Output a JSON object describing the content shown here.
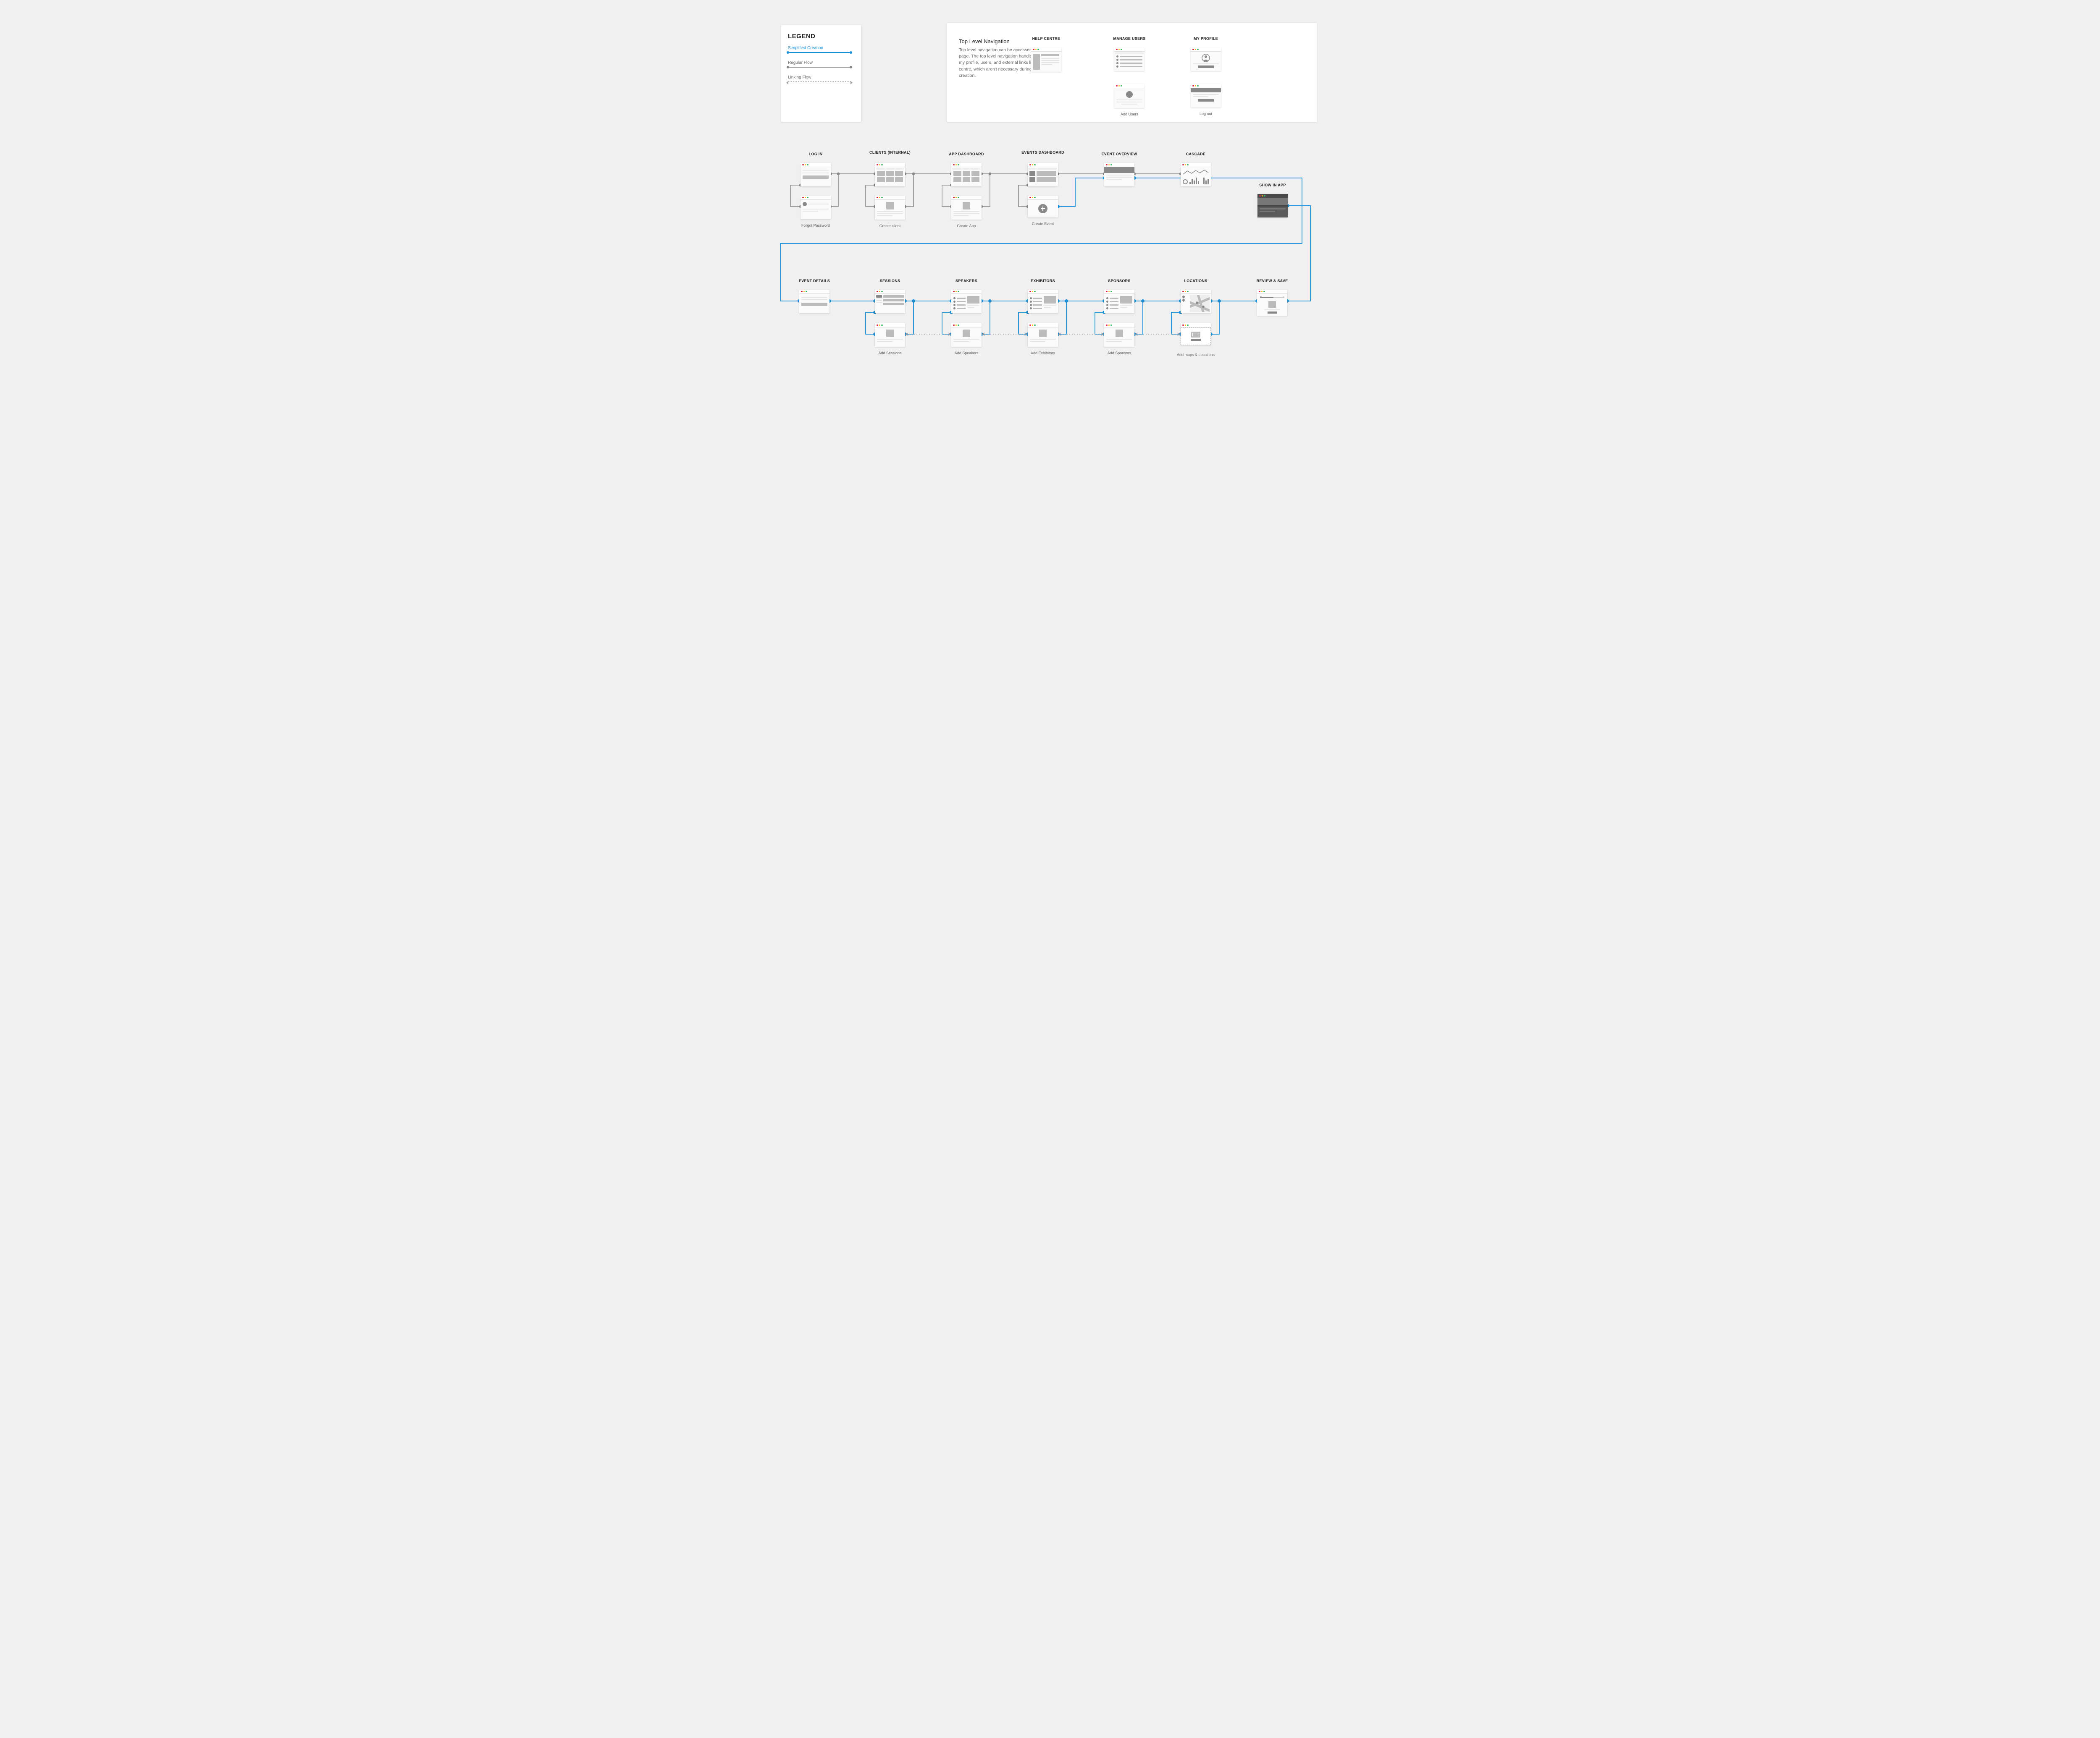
{
  "legend": {
    "title": "LEGEND",
    "simplified": "Simplified Creation",
    "regular": "Regular Flow",
    "linking": "Linking Flow"
  },
  "topNav": {
    "title": "Top Level Navigation",
    "desc": "Top level navigation can be accessed from any page. The top level navigation handles pages like my profile, users, and external links like the help centre, which aren't necessary during event creation.",
    "helpCentre": "HELP CENTRE",
    "manageUsers": "MANAGE USERS",
    "addUsers": "Add Users",
    "myProfile": "MY PROFILE",
    "logOut": "Log out"
  },
  "row1": {
    "login": "LOG IN",
    "forgot": "Forgot Password",
    "clients": "CLIENTS (INTERNAL)",
    "createClient": "Create client",
    "appDash": "APP DASHBOARD",
    "createApp": "Create App",
    "eventsDash": "EVENTS DASHBOARD",
    "createEvent": "Create Event",
    "eventOverview": "EVENT OVERVIEW",
    "cascade": "CASCADE",
    "showInApp": "SHOW IN APP"
  },
  "row2": {
    "eventDetails": "EVENT DETAILS",
    "sessions": "SESSIONS",
    "addSessions": "Add Sessions",
    "speakers": "SPEAKERS",
    "addSpeakers": "Add Speakers",
    "exhibitors": "EXHIBITORS",
    "addExhibitors": "Add Exhibitors",
    "sponsors": "SPONSORS",
    "addSponsors": "Add Sponsors",
    "locations": "LOCATIONS",
    "addLocations": "Add maps & Locations",
    "review": "REVIEW & SAVE"
  }
}
